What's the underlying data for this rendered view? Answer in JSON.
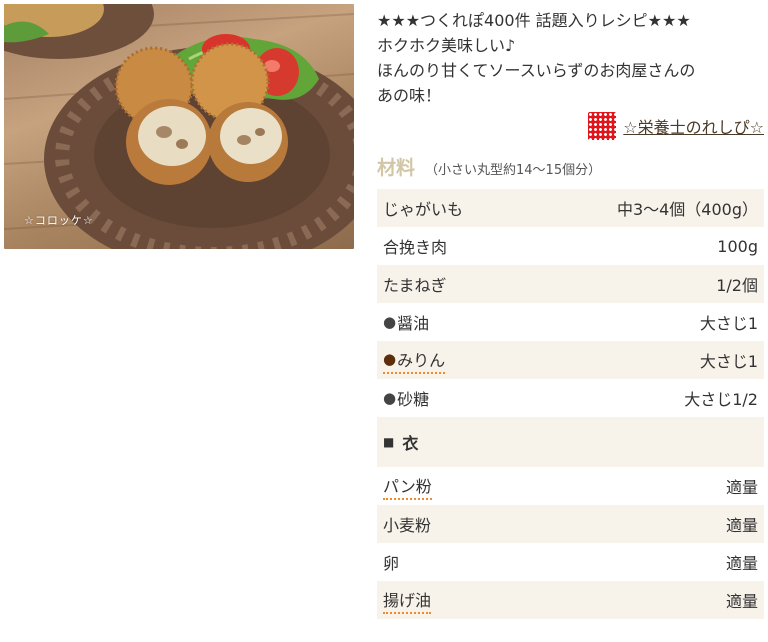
{
  "photo": {
    "caption": "☆コロッケ☆"
  },
  "intro_lines": [
    "★★★つくれぽ400件 話題入りレシピ★★★",
    "ホクホク美味しい♪",
    "ほんのり甘くてソースいらずのお肉屋さんの",
    "あの味！"
  ],
  "author": {
    "name": "☆栄養士のれしぴ☆"
  },
  "ingredients": {
    "title": "材料",
    "servings": "（小さい丸型約14〜15個分）",
    "items": [
      {
        "name": "じゃがいも",
        "qty": "中3〜4個（400g）"
      },
      {
        "name": "合挽き肉",
        "qty": "100g"
      },
      {
        "name": "たまねぎ",
        "qty": "1/2個"
      },
      {
        "bullet": "●",
        "name": "醤油",
        "qty": "大さじ1"
      },
      {
        "bullet": "●",
        "name": "みりん",
        "qty": "大さじ1"
      },
      {
        "bullet": "●",
        "name": "砂糖",
        "qty": "大さじ1/2"
      }
    ],
    "section": {
      "marker": "■",
      "title": "衣"
    },
    "coating_items": [
      {
        "name": "パン粉",
        "qty": "適量"
      },
      {
        "name": "小麦粉",
        "qty": "適量"
      },
      {
        "name": "卵",
        "qty": "適量"
      },
      {
        "name": "揚げ油",
        "qty": "適量"
      }
    ]
  }
}
